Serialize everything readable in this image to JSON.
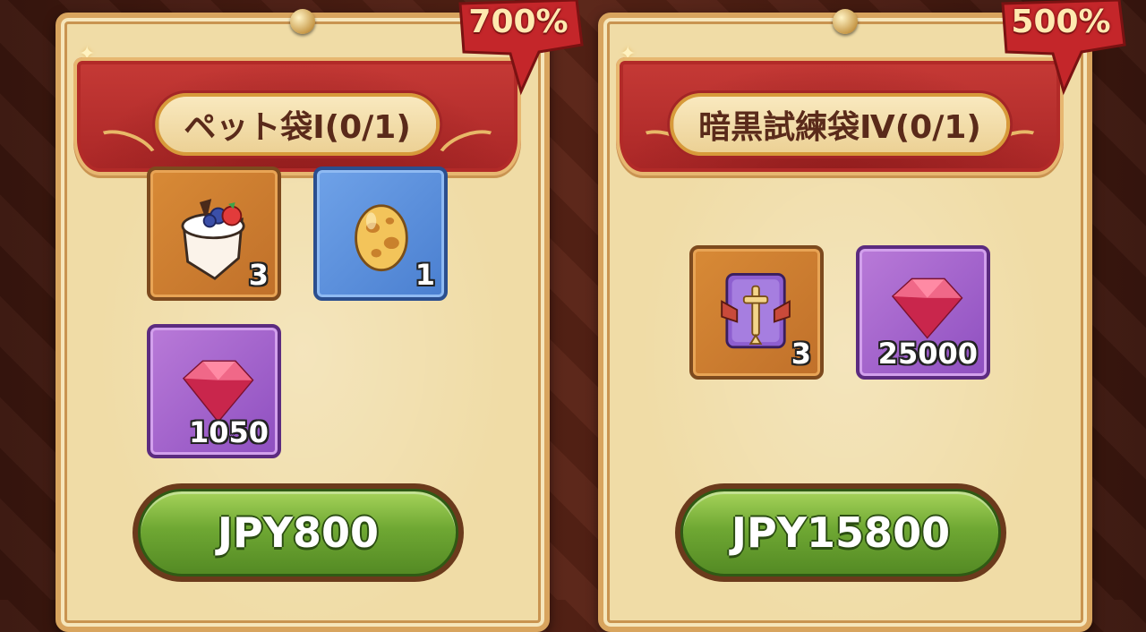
{
  "colors": {
    "background": "#4a1d12",
    "card": "#f0dca6",
    "banner_red": "#b92e2c",
    "badge_red": "#c4262a",
    "button_green": "#6fa833",
    "slot_orange": "#c97a30",
    "slot_blue": "#5a8ede",
    "slot_purple": "#a366cf"
  },
  "offers": [
    {
      "title": "ペット袋Ⅰ(0/1)",
      "badge": "700%",
      "price_label": "JPY800",
      "items": [
        {
          "icon": "cake-icon",
          "rarity": "orange",
          "quantity": "3"
        },
        {
          "icon": "egg-icon",
          "rarity": "blue",
          "quantity": "1"
        },
        {
          "icon": "gem-icon",
          "rarity": "purple",
          "quantity": "1050"
        }
      ]
    },
    {
      "title": "暗黒試練袋Ⅳ(0/1)",
      "badge": "500%",
      "price_label": "JPY15800",
      "items": [
        {
          "icon": "sword-card-icon",
          "rarity": "orange",
          "quantity": "3"
        },
        {
          "icon": "gem-icon",
          "rarity": "purple",
          "quantity": "25000"
        }
      ]
    }
  ]
}
